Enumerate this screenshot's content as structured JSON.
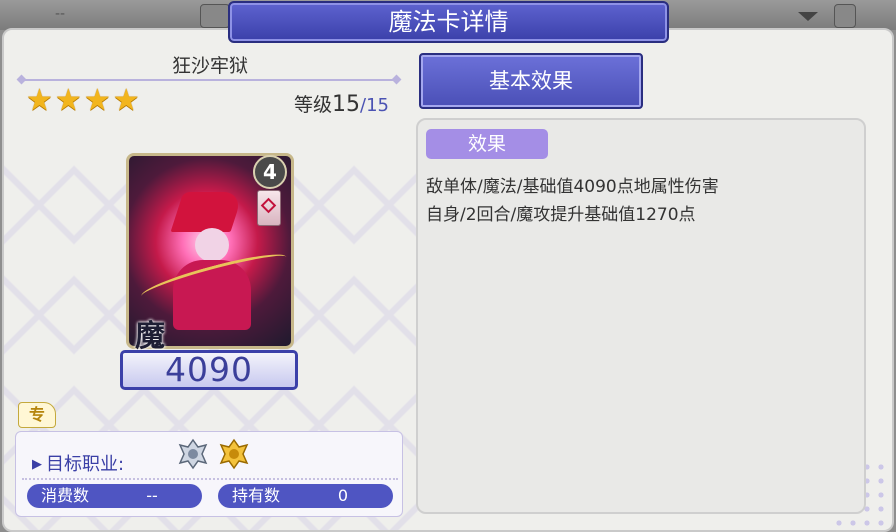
{
  "topbar": {
    "dash": "--"
  },
  "window": {
    "title": "魔法卡详情"
  },
  "card": {
    "name": "狂沙牢狱",
    "stars": 4,
    "level_label": "等级",
    "level_current": "15",
    "level_max": "/15",
    "cost": "4",
    "attribute_char": "魔",
    "value": "4090",
    "special_tag": "专"
  },
  "info": {
    "target_label": "目标职业:",
    "class_icons": [
      "silver-class-emblem-icon",
      "gold-class-emblem-icon"
    ],
    "consume_label": "消费数",
    "consume_value": "--",
    "own_label": "持有数",
    "own_value": "0"
  },
  "effects": {
    "tab_label": "基本效果",
    "tag_label": "效果",
    "lines": [
      "敌单体/魔法/基础值4090点地属性伤害",
      "自身/2回合/魔攻提升基础值1270点"
    ]
  },
  "colors": {
    "accent": "#4f55c2",
    "title_bg": "#3b40a9",
    "effect_tag": "#a48ee6",
    "star": "#f2b51d"
  }
}
